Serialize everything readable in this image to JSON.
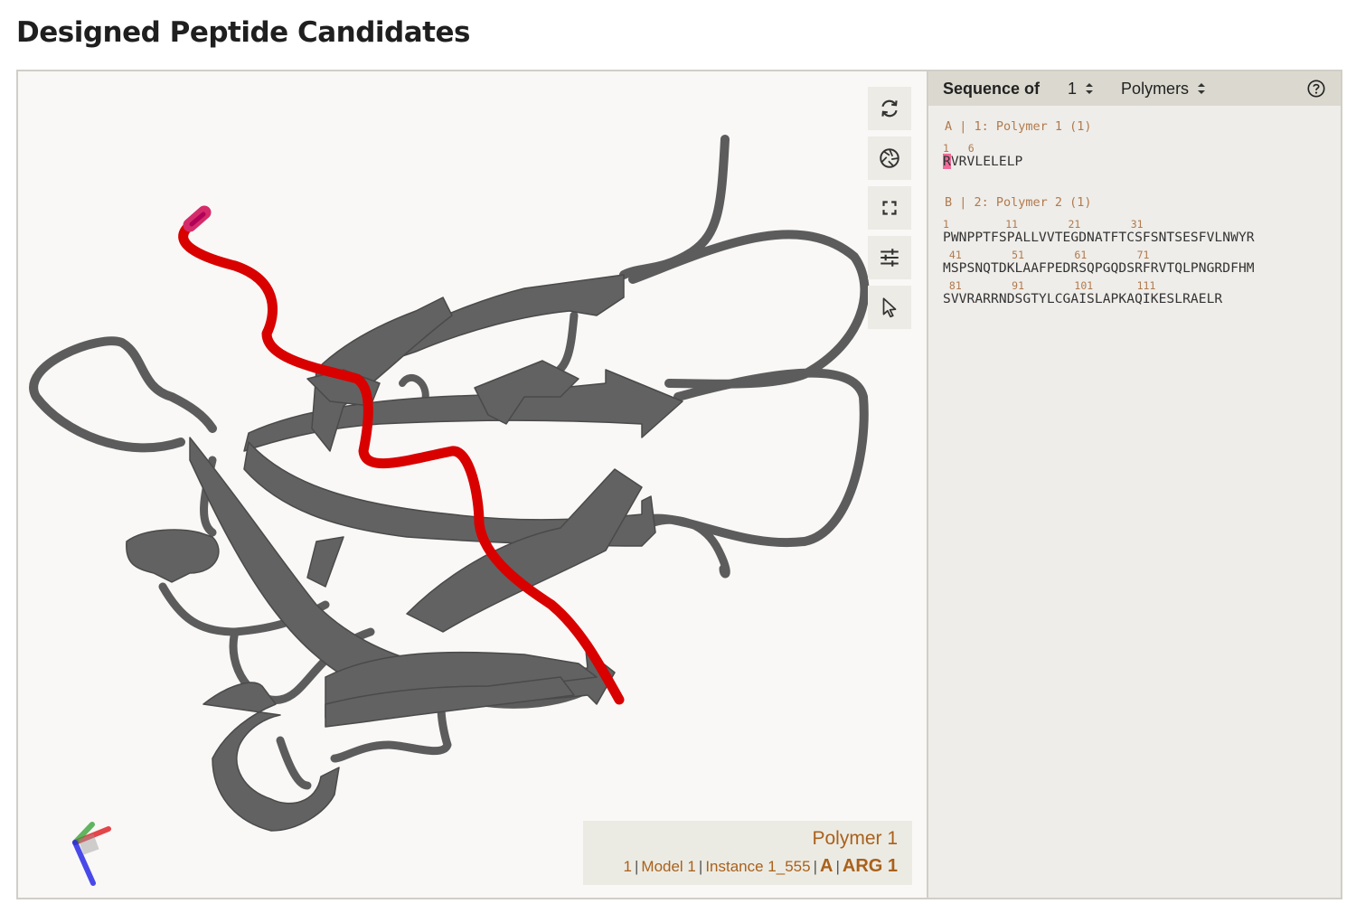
{
  "page": {
    "title": "Designed Peptide Candidates"
  },
  "toolbar": {
    "buttons": [
      {
        "name": "reset-view-button",
        "icon": "refresh-icon"
      },
      {
        "name": "screenshot-button",
        "icon": "camera-aperture-icon"
      },
      {
        "name": "fullscreen-button",
        "icon": "expand-icon"
      },
      {
        "name": "settings-button",
        "icon": "sliders-icon"
      },
      {
        "name": "selection-mode-button",
        "icon": "cursor-icon"
      }
    ]
  },
  "info": {
    "polymer": "Polymer 1",
    "model_index": "1",
    "model": "Model 1",
    "instance": "Instance 1_555",
    "chain": "A",
    "residue": "ARG 1",
    "separator": "|"
  },
  "sequence_panel": {
    "label": "Sequence of",
    "model_select": "1",
    "mode_select": "Polymers",
    "chains": [
      {
        "title": "A | 1: Polymer 1 (1)",
        "numbers": "1   6",
        "lines": [
          "RVRVLELELP"
        ],
        "highlighted_residue": "R"
      },
      {
        "title": "B | 2: Polymer 2 (1)",
        "numbers": [
          "1         11        21        31",
          " 41        51        61        71",
          " 81        91        101       111"
        ],
        "lines": [
          "PWNPPTFSPALLVVTEGDNATFTCSFSNTSESFVLNWYR",
          "MSPSNQTDKLAAFPEDRSQPGQDSRFRVTQLPNGRDFHM",
          "SVVRARRNDSGTYLCGAISLAPKAQIKESLRAELR"
        ]
      }
    ]
  },
  "colors": {
    "peptide": "#d90000",
    "protein": "#5c5c5c",
    "accent": "#a9611c",
    "highlight": "#f06a99"
  }
}
